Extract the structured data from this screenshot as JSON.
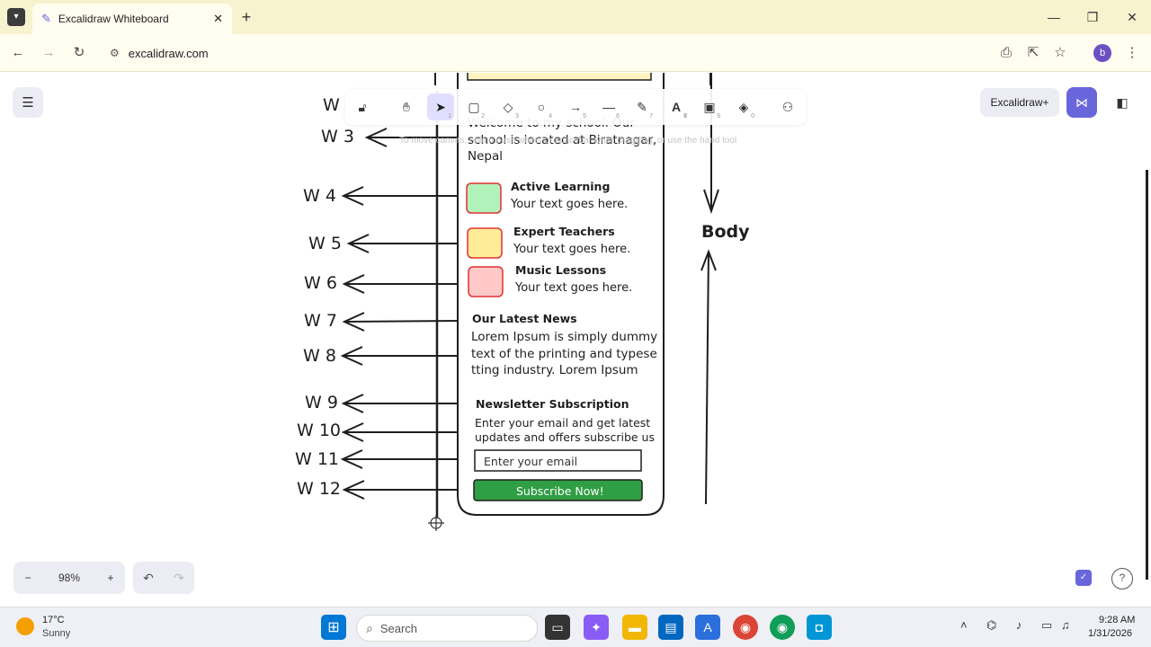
{
  "browser": {
    "tab_title": "Excalidraw Whiteboard",
    "url": "excalidraw.com",
    "profile_initial": "b"
  },
  "toolbar": {
    "tools": [
      {
        "name": "lock",
        "key": ""
      },
      {
        "name": "hand",
        "key": ""
      },
      {
        "name": "selection",
        "key": "1"
      },
      {
        "name": "rectangle",
        "key": "2"
      },
      {
        "name": "diamond",
        "key": "3"
      },
      {
        "name": "ellipse",
        "key": "4"
      },
      {
        "name": "arrow",
        "key": "5"
      },
      {
        "name": "line",
        "key": "6"
      },
      {
        "name": "draw",
        "key": "7"
      },
      {
        "name": "text",
        "key": "8"
      },
      {
        "name": "image",
        "key": "9"
      },
      {
        "name": "eraser",
        "key": "0"
      },
      {
        "name": "extra-tools",
        "key": ""
      }
    ],
    "hint": "To move canvas, hold mouse wheel or spacebar while dragging, or use the hand tool"
  },
  "header_right": {
    "excalidraw_plus": "Excalidraw+"
  },
  "drawing": {
    "w_labels": [
      "W",
      "W 3",
      "W 4",
      "W 5",
      "W 6",
      "W 7",
      "W 8",
      "W 9",
      "W 10",
      "W 11",
      "W 12"
    ],
    "body_label": "Body",
    "intro_line1": "Welcome to my school. Our",
    "intro_line2": "school is located at Biratnagar,",
    "intro_line3": "Nepal",
    "features": [
      {
        "title": "Active Learning",
        "text": "Your text goes here.",
        "color": "#b2f2bb"
      },
      {
        "title": "Expert Teachers",
        "text": "Your text goes here.",
        "color": "#ffec99"
      },
      {
        "title": "Music Lessons",
        "text": "Your text goes here.",
        "color": "#ffc9c9"
      }
    ],
    "news_title": "Our Latest News",
    "news_line1": "Lorem Ipsum is simply dummy",
    "news_line2": "text of the printing and typese",
    "news_line3": "tting industry. Lorem Ipsum",
    "newsletter_title": "Newsletter Subscription",
    "newsletter_line1": "Enter your email and get latest",
    "newsletter_line2": "updates and offers subscribe us",
    "email_placeholder": "Enter your email",
    "subscribe_label": "Subscribe Now!",
    "subscribe_color": "#2f9e44"
  },
  "footer": {
    "zoom_minus": "−",
    "zoom_level": "98%",
    "zoom_plus": "+"
  },
  "taskbar": {
    "temperature": "17°C",
    "weather": "Sunny",
    "search_placeholder": "Search",
    "time": "9:28 AM",
    "date": "1/31/2026"
  },
  "colors": {
    "accent": "#6965db",
    "tabbar_bg": "#f7f3cf"
  }
}
